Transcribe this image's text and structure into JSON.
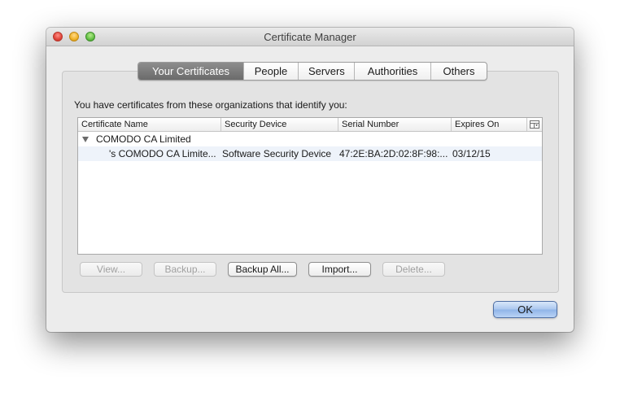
{
  "window": {
    "title": "Certificate Manager"
  },
  "tabs": [
    {
      "label": "Your Certificates",
      "selected": true
    },
    {
      "label": "People",
      "selected": false
    },
    {
      "label": "Servers",
      "selected": false
    },
    {
      "label": "Authorities",
      "selected": false
    },
    {
      "label": "Others",
      "selected": false
    }
  ],
  "description": "You have certificates from these organizations that identify you:",
  "table": {
    "columns": [
      "Certificate Name",
      "Security Device",
      "Serial Number",
      "Expires On"
    ],
    "column_picker_icon": "column-picker-icon",
    "rows": [
      {
        "type": "group",
        "expanded": true,
        "name": "COMODO CA Limited"
      },
      {
        "type": "certificate",
        "name": "'s COMODO CA Limite...",
        "device": "Software Security Device",
        "serial": "47:2E:BA:2D:02:8F:98:...",
        "expires": "03/12/15"
      }
    ]
  },
  "buttons": {
    "view": {
      "label": "View...",
      "enabled": false
    },
    "backup": {
      "label": "Backup...",
      "enabled": false
    },
    "backup_all": {
      "label": "Backup All...",
      "enabled": true
    },
    "import": {
      "label": "Import...",
      "enabled": true
    },
    "delete": {
      "label": "Delete...",
      "enabled": false
    }
  },
  "ok_button": {
    "label": "OK"
  },
  "colors": {
    "selected_tab": "#7a7a7a",
    "ok_accent": "#8fb4e8",
    "row_highlight": "#eef3fa"
  }
}
